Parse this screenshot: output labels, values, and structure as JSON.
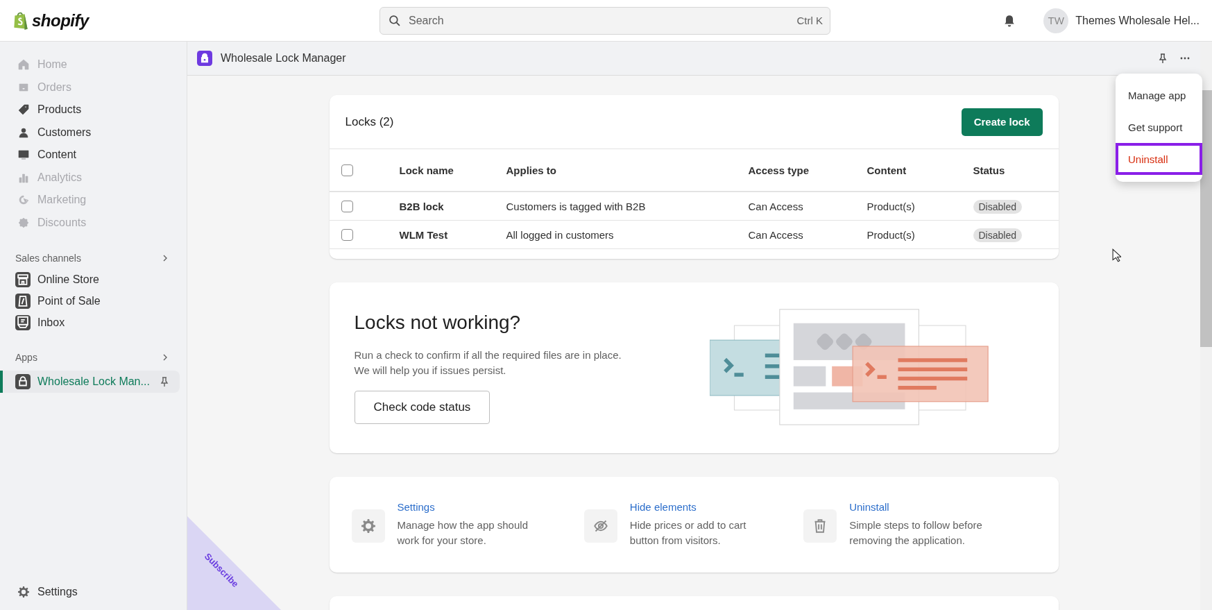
{
  "topbar": {
    "logo": "shopify",
    "search": {
      "placeholder": "Search",
      "shortcut": "Ctrl K"
    },
    "account": {
      "initials": "TW",
      "name": "Themes Wholesale Hel..."
    }
  },
  "sidebar": {
    "items": [
      {
        "label": "Home",
        "disabled": true
      },
      {
        "label": "Orders",
        "disabled": true
      },
      {
        "label": "Products",
        "disabled": false
      },
      {
        "label": "Customers",
        "disabled": false
      },
      {
        "label": "Content",
        "disabled": false
      },
      {
        "label": "Analytics",
        "disabled": true
      },
      {
        "label": "Marketing",
        "disabled": true
      },
      {
        "label": "Discounts",
        "disabled": true
      }
    ],
    "sales_channels": {
      "heading": "Sales channels",
      "items": [
        {
          "label": "Online Store"
        },
        {
          "label": "Point of Sale"
        },
        {
          "label": "Inbox"
        }
      ]
    },
    "apps": {
      "heading": "Apps",
      "items": [
        {
          "label": "Wholesale Lock Man...",
          "selected": true
        }
      ]
    },
    "settings": "Settings"
  },
  "app_header": {
    "title": "Wholesale Lock Manager"
  },
  "menu": {
    "items": [
      {
        "label": "Manage app",
        "destructive": false,
        "highlighted": false
      },
      {
        "label": "Get support",
        "destructive": false,
        "highlighted": false
      },
      {
        "label": "Uninstall",
        "destructive": true,
        "highlighted": true
      }
    ]
  },
  "locks": {
    "title": "Locks (2)",
    "button": "Create lock",
    "header_checked": false,
    "columns": [
      "Lock name",
      "Applies to",
      "Access type",
      "Content",
      "Status"
    ],
    "rows": [
      {
        "name": "B2B lock",
        "applies_to": "Customers is tagged with B2B",
        "access_type": "Can Access",
        "content": "Product(s)",
        "status": "Disabled",
        "checked": false
      },
      {
        "name": "WLM Test",
        "applies_to": "All logged in customers",
        "access_type": "Can Access",
        "content": "Product(s)",
        "status": "Disabled",
        "checked": false
      }
    ]
  },
  "check_card": {
    "title": "Locks not working?",
    "text": "Run a check to confirm if all the required files are in place.\nWe will help you if issues persist.",
    "button": "Check code status"
  },
  "features": [
    {
      "title": "Settings",
      "text": "Manage how the app should\nwork for your store."
    },
    {
      "title": "Hide elements",
      "text": "Hide prices or add to cart\nbutton from visitors."
    },
    {
      "title": "Uninstall",
      "text": "Simple steps to follow before\nremoving the application."
    }
  ],
  "ribbon": {
    "label": "Subscribe"
  }
}
